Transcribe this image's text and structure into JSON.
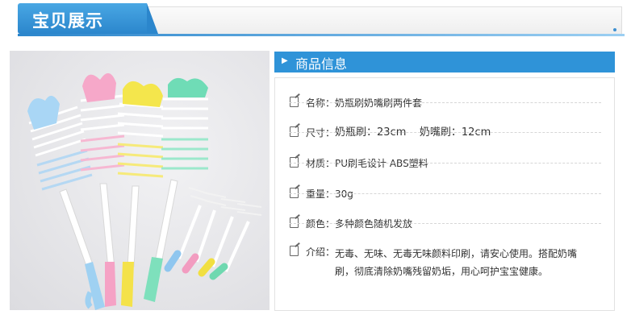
{
  "banner": {
    "title": "宝贝展示"
  },
  "photo": {
    "alt": ""
  },
  "info": {
    "header": "商品信息",
    "rows": [
      {
        "label": "名称：",
        "value": "奶瓶刷奶嘴刷两件套"
      },
      {
        "label": "尺寸：",
        "value": "奶瓶刷：23cm    奶嘴刷：12cm"
      },
      {
        "label": "材质：",
        "value": "PU刷毛设计 ABS塑料"
      },
      {
        "label": "重量：",
        "value": "30g"
      },
      {
        "label": "颜色：",
        "value": "多种颜色随机发放"
      },
      {
        "label": "介绍：",
        "value": "无毒、无味、无毒无味颜料印刷，请安心使用。搭配奶嘴刷，彻底清除奶嘴残留奶垢，用心呵护宝宝健康。"
      }
    ]
  },
  "colors": {
    "accent": "#2f93d8",
    "brush_blue": "#a9d6f5",
    "brush_pink": "#f6a8c9",
    "brush_yellow": "#f4e64c",
    "brush_green": "#6fdcb6"
  }
}
